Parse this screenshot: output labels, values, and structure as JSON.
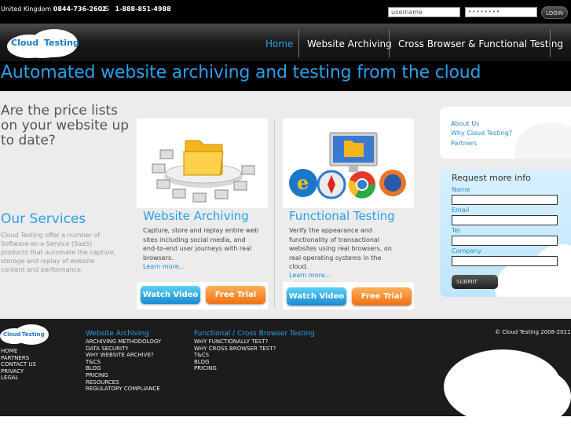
{
  "topbar": {
    "uk_label": "United Kingdom",
    "uk_number": "0844-736-2602",
    "us_label": "US",
    "us_number": "1-888-851-4988",
    "username_placeholder": "username",
    "password_value": "••••••••",
    "login_label": "LOGIN"
  },
  "logo": {
    "word1": "Cloud",
    "word2": "Testing"
  },
  "nav": {
    "items": [
      "Home",
      "Website Archiving",
      "Cross Browser & Functional Testing"
    ],
    "active_index": 0
  },
  "hero": {
    "title": "Automated website archiving and testing from the cloud"
  },
  "intro": {
    "question": [
      "Are the price lists",
      "on your website up",
      "to date?"
    ],
    "services_title": "Our Services",
    "services_text": "Cloud Testing offer a number of Software-as-a-Service (SaaS) products that automate the capture, storage and replay of website content and performance."
  },
  "cards": [
    {
      "title": "Website Archiving",
      "text": "Capture, store and replay entire web sites including social media, and end-to-end user journeys with real browsers.",
      "learn_more": "Learn more...",
      "watch_label": "Watch Video",
      "trial_label": "Free Trial"
    },
    {
      "title": "Functional Testing",
      "text": "Verify the appearance and functionality of transactional websites using real browsers, on real operating systems in the cloud.",
      "learn_more": "Learn more...",
      "watch_label": "Watch Video",
      "trial_label": "Free Trial"
    }
  ],
  "sidebar": {
    "links": [
      "About Us",
      "Why Cloud Testing?",
      "Partners"
    ],
    "request_title": "Request more info",
    "fields": [
      "Name",
      "Email",
      "Tel",
      "Company"
    ],
    "submit_label": "SUBMIT"
  },
  "footer": {
    "col1_links": [
      "Home",
      "Partners",
      "Contact Us",
      "Privacy",
      "Legal"
    ],
    "col2_title": "Website Archiving",
    "col2_links": [
      "Archiving Methodology",
      "Data Security",
      "Why Website Archive?",
      "T&Cs",
      "Blog",
      "Pricing",
      "Resources",
      "Regulatory Compliance"
    ],
    "col3_title": "Functional / Cross Browser Testing",
    "col3_links": [
      "Why Functionally Test?",
      "Why Cross Browser Test?",
      "T&Cs",
      "Blog",
      "Pricing"
    ],
    "copyright": "© Cloud Testing 2008-2011"
  },
  "colors": {
    "accent": "#2aa0e8",
    "trial": "#f07010",
    "watch": "#1a8ad0"
  },
  "icons": [
    "folder-network-icon",
    "browser-icons"
  ]
}
